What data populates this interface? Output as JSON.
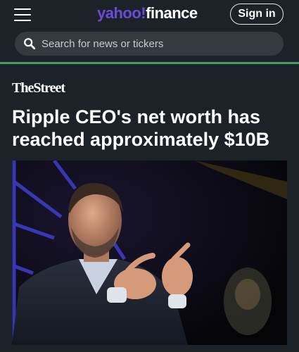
{
  "header": {
    "logo_main": "yahoo",
    "logo_bang": "!",
    "logo_sub": "finance",
    "signin_label": "Sign in",
    "search_placeholder": "Search for news or tickers"
  },
  "article": {
    "source": "TheStreet",
    "headline": "Ripple CEO's net worth has reached approximately $10B"
  },
  "colors": {
    "background": "#1d2228",
    "accent_green": "#4c9a6a",
    "logo_purple": "#6b4bd8"
  }
}
